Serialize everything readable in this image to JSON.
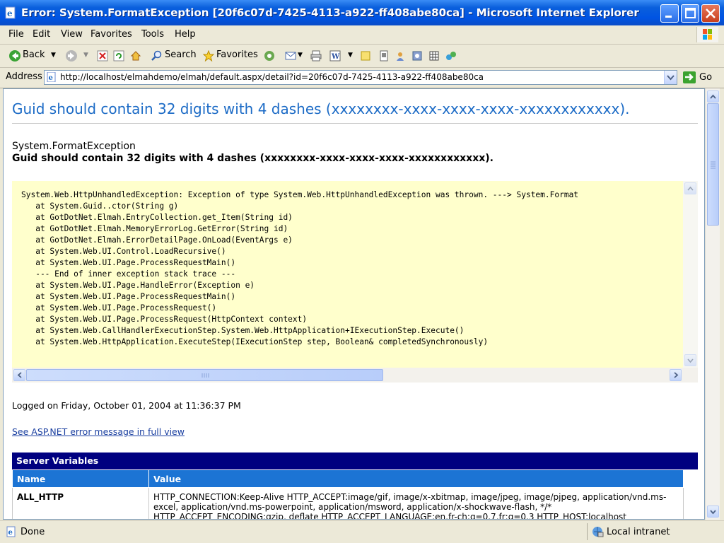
{
  "window": {
    "title": "Error: System.FormatException [20f6c07d-7425-4113-a922-ff408abe80ca] - Microsoft Internet Explorer"
  },
  "menu": {
    "items": [
      "File",
      "Edit",
      "View",
      "Favorites",
      "Tools",
      "Help"
    ]
  },
  "toolbar": {
    "back_label": "Back",
    "search_label": "Search",
    "favorites_label": "Favorites"
  },
  "address": {
    "label": "Address",
    "url": "http://localhost/elmahdemo/elmah/default.aspx/detail?id=20f6c07d-7425-4113-a922-ff408abe80ca",
    "go_label": "Go"
  },
  "page": {
    "heading": "Guid should contain 32 digits with 4 dashes (xxxxxxxx-xxxx-xxxx-xxxx-xxxxxxxxxxxx).",
    "exception_type": "System.FormatException",
    "exception_message": "Guid should contain 32 digits with 4 dashes (xxxxxxxx-xxxx-xxxx-xxxx-xxxxxxxxxxxx).",
    "stack_trace": [
      "System.Web.HttpUnhandledException: Exception of type System.Web.HttpUnhandledException was thrown. ---> System.Format",
      "   at System.Guid..ctor(String g)",
      "   at GotDotNet.Elmah.EntryCollection.get_Item(String id)",
      "   at GotDotNet.Elmah.MemoryErrorLog.GetError(String id)",
      "   at GotDotNet.Elmah.ErrorDetailPage.OnLoad(EventArgs e)",
      "   at System.Web.UI.Control.LoadRecursive()",
      "   at System.Web.UI.Page.ProcessRequestMain()",
      "   --- End of inner exception stack trace ---",
      "   at System.Web.UI.Page.HandleError(Exception e)",
      "   at System.Web.UI.Page.ProcessRequestMain()",
      "   at System.Web.UI.Page.ProcessRequest()",
      "   at System.Web.UI.Page.ProcessRequest(HttpContext context)",
      "   at System.Web.CallHandlerExecutionStep.System.Web.HttpApplication+IExecutionStep.Execute()",
      "   at System.Web.HttpApplication.ExecuteStep(IExecutionStep step, Boolean& completedSynchronously)"
    ],
    "logged_on": "Logged on Friday, October 01, 2004 at 11:36:37 PM",
    "full_view_link": "See ASP.NET error message in full view",
    "server_variables": {
      "title": "Server Variables",
      "columns": [
        "Name",
        "Value"
      ],
      "rows": [
        {
          "name": "ALL_HTTP",
          "value": "HTTP_CONNECTION:Keep-Alive HTTP_ACCEPT:image/gif, image/x-xbitmap, image/jpeg, image/pjpeg, application/vnd.ms-excel, application/vnd.ms-powerpoint, application/msword, application/x-shockwave-flash, */* HTTP_ACCEPT_ENCODING:gzip, deflate HTTP_ACCEPT_LANGUAGE:en,fr-ch;q=0.7,fr;q=0.3 HTTP_HOST:localhost"
        }
      ]
    }
  },
  "status": {
    "text": "Done",
    "zone": "Local intranet"
  },
  "colors": {
    "heading": "#1c6bc6",
    "trace_background": "#ffffcc",
    "section_header": "#000080",
    "table_header": "#1c74d4",
    "link": "#1a3fa0"
  },
  "icons": [
    "ie-page-icon",
    "minimize-icon",
    "maximize-icon",
    "close-icon",
    "windows-logo-icon",
    "back-icon",
    "forward-icon",
    "stop-icon",
    "refresh-icon",
    "home-icon",
    "search-icon",
    "favorites-icon",
    "media-icon",
    "mail-icon",
    "print-icon",
    "edit-icon",
    "discuss-icon",
    "research-icon",
    "messenger-icon",
    "go-icon",
    "done-icon",
    "intranet-icon"
  ]
}
